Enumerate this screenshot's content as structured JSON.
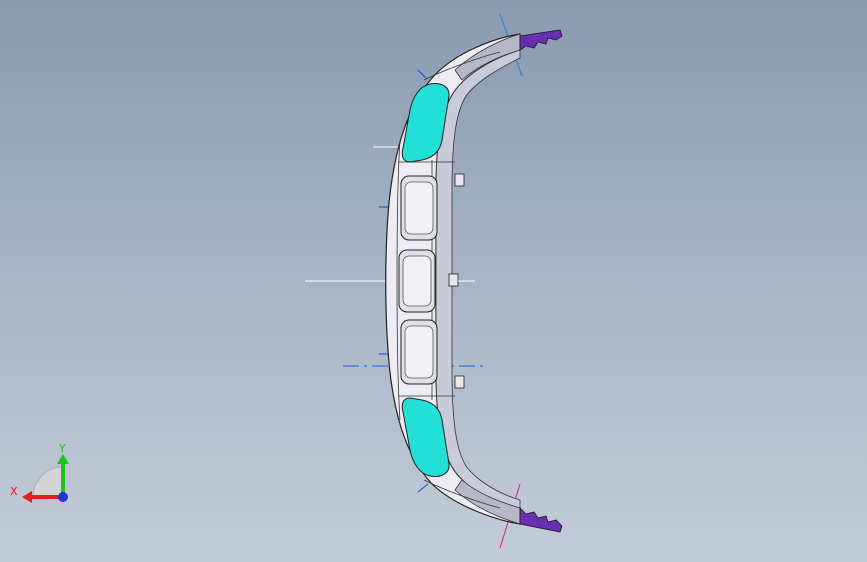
{
  "viewport": {
    "background_top": "#8a9bb0",
    "background_bottom": "#c4ccd7",
    "model": {
      "body_fill": "#ececf2",
      "shadow_fill": "#b6b8c8",
      "glass_fill": "#22e0d8",
      "edge_color": "#222222",
      "clip_color": "#6a2fb0"
    },
    "triad": {
      "x_label": "X",
      "y_label": "Y",
      "x_color": "#e02020",
      "y_color": "#1fc21f",
      "z_color": "#2233dd"
    }
  }
}
